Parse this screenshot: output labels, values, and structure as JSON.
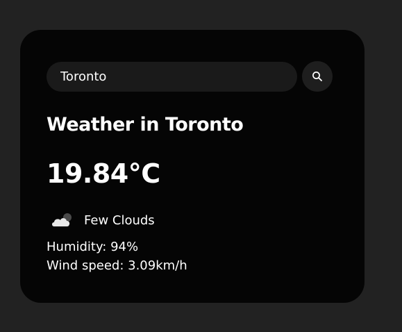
{
  "search": {
    "value": "Toronto",
    "placeholder": "Search"
  },
  "weather": {
    "title": "Weather in Toronto",
    "temperature": "19.84°C",
    "icon": "few-clouds-icon",
    "description": "Few Clouds",
    "humidity": "Humidity: 94%",
    "wind": "Wind speed: 3.09km/h"
  },
  "colors": {
    "page_background": "#222222",
    "card_background": "#050505",
    "input_background": "#1a1a1a",
    "text": "#ffffff"
  }
}
